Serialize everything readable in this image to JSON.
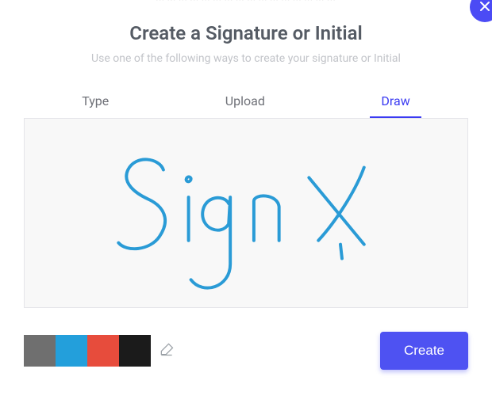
{
  "ghost_line": "··· ··· ··· ··· ··· ··· ··· ··· ··· ··· ··· ··· ··· ··· ··· ···",
  "header": {
    "title": "Create a Signature or Initial",
    "subtitle": "Use one of the following ways to create your signature or Initial"
  },
  "tabs": {
    "type": "Type",
    "upload": "Upload",
    "draw": "Draw",
    "active": "draw"
  },
  "signature_sample_text": "SignX",
  "palette": {
    "colors": [
      "#6f6f6f",
      "#239fdb",
      "#e74c3c",
      "#1b1b1b"
    ],
    "selected_index": 1
  },
  "actions": {
    "create_label": "Create"
  }
}
